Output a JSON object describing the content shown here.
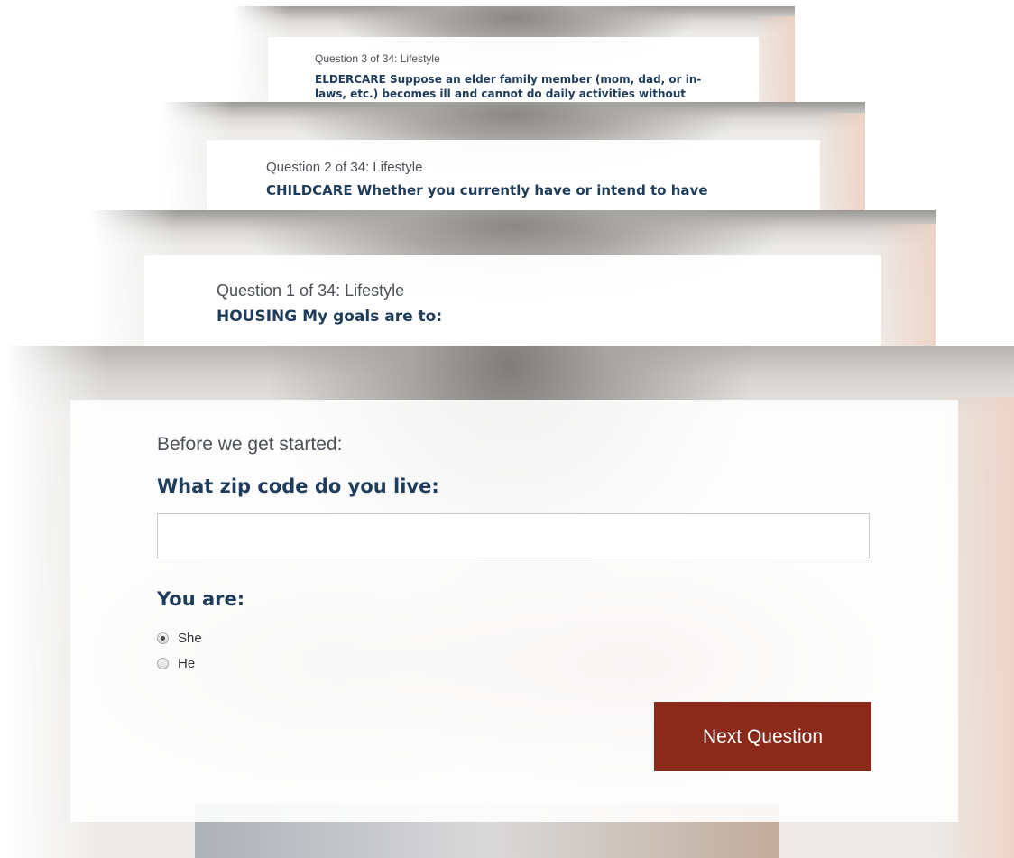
{
  "slides": [
    {
      "question_meta": "Question 3 of 34: Lifestyle",
      "question_text": "ELDERCARE Suppose an elder family member (mom, dad, or in-laws, etc.) becomes ill and cannot do daily activities without"
    },
    {
      "question_meta": "Question 2 of 34: Lifestyle",
      "question_text": "CHILDCARE Whether you currently have or intend to have"
    },
    {
      "question_meta": "Question 1 of 34: Lifestyle",
      "question_text": "HOUSING My goals are to:"
    }
  ],
  "main": {
    "intro": "Before we get started:",
    "zip_label": "What zip code do you live:",
    "zip_value": "",
    "zip_placeholder": "",
    "gender_label": "You are:",
    "options": [
      {
        "label": "She",
        "checked": true
      },
      {
        "label": "He",
        "checked": false
      }
    ],
    "next_button": "Next Question"
  },
  "colors": {
    "button": "#8b2a1a",
    "heading": "#1f3c5a"
  }
}
